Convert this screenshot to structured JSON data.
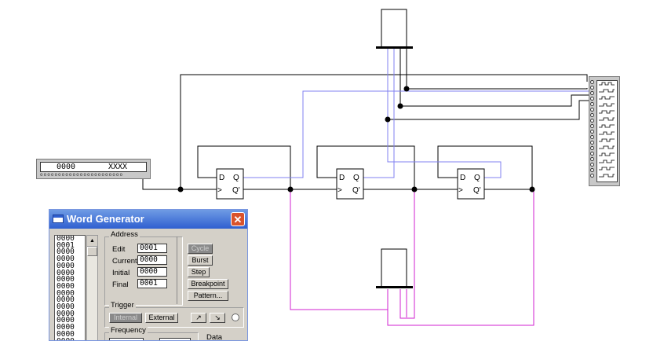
{
  "word_generator_instrument": {
    "current_word": "0000",
    "final_word": "XXXX"
  },
  "dialog": {
    "title": "Word Generator",
    "words": [
      "0000",
      "0001",
      "0000",
      "0000",
      "0000",
      "0000",
      "0000",
      "0000",
      "0000",
      "0000",
      "0000",
      "0000",
      "0000",
      "0000",
      "0000",
      "0000"
    ],
    "address": {
      "group_label": "Address",
      "edit_label": "Edit",
      "edit_value": "0001",
      "current_label": "Current",
      "current_value": "0000",
      "initial_label": "Initial",
      "initial_value": "0000",
      "final_label": "Final",
      "final_value": "0001"
    },
    "buttons": {
      "cycle": "Cycle",
      "burst": "Burst",
      "step": "Step",
      "breakpoint": "Breakpoint",
      "pattern": "Pattern..."
    },
    "trigger": {
      "group_label": "Trigger",
      "internal": "Internal",
      "external": "External"
    },
    "frequency": {
      "group_label": "Frequency"
    },
    "data_label": "Data"
  },
  "flip_flops": [
    {
      "d": "D",
      "q": "Q",
      "clk": ">",
      "qn": "Q'"
    },
    {
      "d": "D",
      "q": "Q",
      "clk": ">",
      "qn": "Q'"
    },
    {
      "d": "D",
      "q": "Q",
      "clk": ">",
      "qn": "Q'"
    }
  ],
  "colors": {
    "wire": "#000000",
    "probe_blue": "#8080f0",
    "probe_magenta": "#d020d0",
    "titlebar": "#2f5fd0"
  }
}
